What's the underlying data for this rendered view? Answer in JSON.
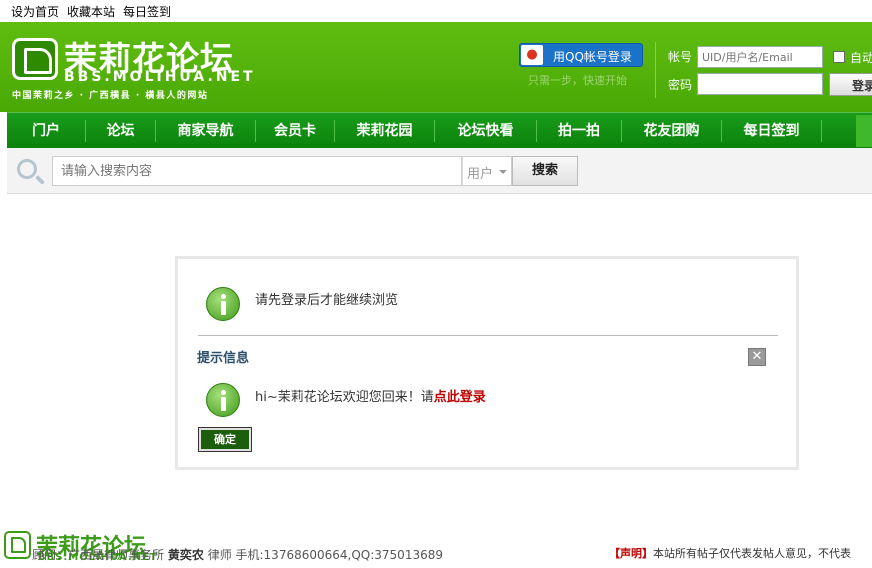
{
  "topbar": {
    "links": [
      "设为首页",
      "收藏本站",
      "每日签到"
    ]
  },
  "header": {
    "logo_title": "茉莉花论坛",
    "logo_domain": "BBS.MOLIHUA.NET",
    "logo_slogan": "中国茉莉之乡 · 广西横县 · 横县人的网站",
    "qq_login_label": "用QQ帐号登录",
    "qq_hint": "只需一步，快速开始",
    "account_label": "帐号",
    "account_placeholder": "UID/用户名/Email",
    "password_label": "密码",
    "auto_login_label": "自动",
    "login_button": "登录"
  },
  "nav": {
    "items": [
      "门户",
      "论坛",
      "商家导航",
      "会员卡",
      "茉莉花园",
      "论坛快看",
      "拍一拍",
      "花友团购",
      "每日签到"
    ]
  },
  "search": {
    "placeholder": "请输入搜索内容",
    "type_selected": "用户",
    "button": "搜索"
  },
  "message": {
    "main_text": "请先登录后才能继续浏览",
    "heading": "提示信息",
    "welcome_text": "hi~茉莉花论坛欢迎您回来！请",
    "login_link": "点此登录",
    "ok_button": "确定",
    "close_icon": "✕"
  },
  "footer": {
    "logo_title": "茉莉花论坛",
    "logo_domain": "BBS.MOLIHUA.NET",
    "legal_text_prefix": "顾问：广西晟律师事务所",
    "lawyer_name": "黄奕农",
    "legal_text_suffix": "律师 手机:13768600664,QQ:375013689",
    "notice_tag": "【声明】",
    "notice_text": "本站所有帖子仅代表发帖人意见，不代表"
  },
  "colors": {
    "header_green": "#58b60a",
    "nav_green": "#0b820b",
    "link_red": "#c00000",
    "heading_blue": "#2c4f6c"
  }
}
